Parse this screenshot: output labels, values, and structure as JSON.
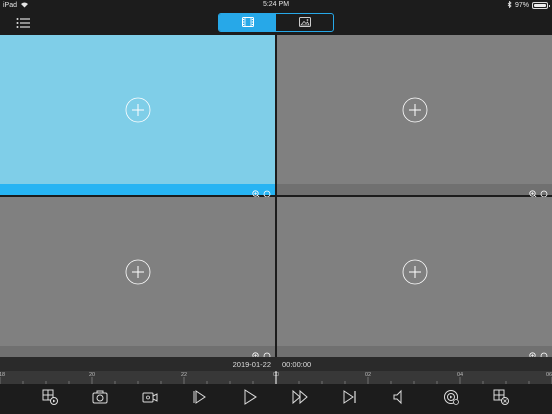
{
  "status_bar": {
    "device": "iPad",
    "time": "5:24 PM",
    "battery": "97%",
    "battery_level": 0.97
  },
  "view_toggle": {
    "options": [
      "live-view",
      "playback-view"
    ],
    "selected": "live-view"
  },
  "cells": [
    {
      "id": "channel-1",
      "selected": true,
      "label": ""
    },
    {
      "id": "channel-2",
      "selected": false,
      "label": ""
    },
    {
      "id": "channel-3",
      "selected": false,
      "label": ""
    },
    {
      "id": "channel-4",
      "selected": false,
      "label": ""
    }
  ],
  "playback": {
    "date": "2019-01-22",
    "time": "00:00:00"
  },
  "timeline": {
    "ticks": [
      "18",
      "20",
      "22",
      "00",
      "02",
      "04",
      "06"
    ],
    "cursor": "00"
  },
  "colors": {
    "accent": "#27a8e8",
    "selected_cell": "#7fcee8",
    "cell": "#808080"
  },
  "toolbar": [
    "window-layout-icon",
    "snapshot-icon",
    "record-icon",
    "slow-play-icon",
    "play-icon",
    "fast-forward-icon",
    "next-frame-icon",
    "audio-icon",
    "playback-search-icon",
    "close-all-icon"
  ]
}
